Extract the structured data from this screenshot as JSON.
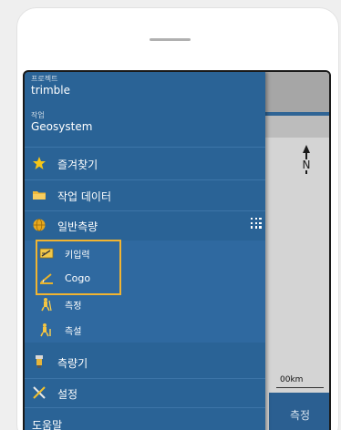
{
  "drawer": {
    "project": {
      "caption": "프로젝트",
      "value": "trimble"
    },
    "job": {
      "caption": "작업",
      "value": "Geosystem"
    },
    "items": [
      {
        "label": "즐겨찾기",
        "icon": "star-icon"
      },
      {
        "label": "작업 데이터",
        "icon": "folder-icon"
      },
      {
        "label": "일반측량",
        "icon": "globe-icon"
      },
      {
        "label": "측량기",
        "icon": "instrument-icon"
      },
      {
        "label": "설정",
        "icon": "settings-tools-icon"
      },
      {
        "label": "도움말",
        "icon": "help-icon"
      }
    ],
    "subitems": [
      {
        "label": "키입력",
        "icon": "keyboard-entry-icon"
      },
      {
        "label": "Cogo",
        "icon": "cogo-icon"
      },
      {
        "label": "측정",
        "icon": "surveyor-measure-icon"
      },
      {
        "label": "측설",
        "icon": "surveyor-stakeout-icon"
      }
    ]
  },
  "map": {
    "north_label": "N",
    "scale_label": "00km",
    "measure_button": "측정"
  },
  "colors": {
    "drawer_bg": "#2a6396",
    "highlight_border": "#f1b431",
    "star": "#f5c518"
  }
}
